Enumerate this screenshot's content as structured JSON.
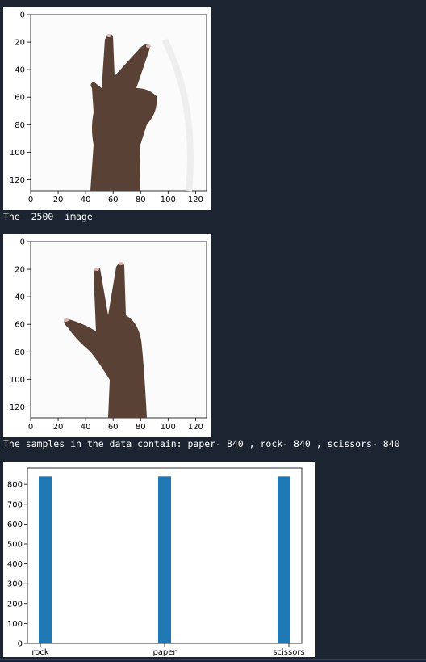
{
  "outputs": [
    {
      "kind": "image-plot",
      "x_ticks": [
        "0",
        "20",
        "40",
        "60",
        "80",
        "100",
        "120"
      ],
      "y_ticks": [
        "0",
        "20",
        "40",
        "60",
        "80",
        "100",
        "120"
      ],
      "description": "hand-gesture-scissors"
    },
    {
      "kind": "stdout",
      "text": "The  2500  image"
    },
    {
      "kind": "image-plot",
      "x_ticks": [
        "0",
        "20",
        "40",
        "60",
        "80",
        "100",
        "120"
      ],
      "y_ticks": [
        "0",
        "20",
        "40",
        "60",
        "80",
        "100",
        "120"
      ],
      "description": "hand-gesture-scissors"
    },
    {
      "kind": "stdout",
      "text": "The samples in the data contain: paper- 840 , rock- 840 , scissors- 840"
    }
  ],
  "chart_data": {
    "type": "bar",
    "categories": [
      "rock",
      "paper",
      "scissors"
    ],
    "values": [
      840,
      840,
      840
    ],
    "y_ticks": [
      "0",
      "100",
      "200",
      "300",
      "400",
      "500",
      "600",
      "700",
      "800"
    ],
    "ylim": [
      0,
      882
    ],
    "bar_color": "#1f77b4",
    "title": "",
    "xlabel": "",
    "ylabel": ""
  },
  "theme": {
    "background": "#1b2430",
    "text": "#ffffff",
    "bar": "#1f77b4"
  }
}
